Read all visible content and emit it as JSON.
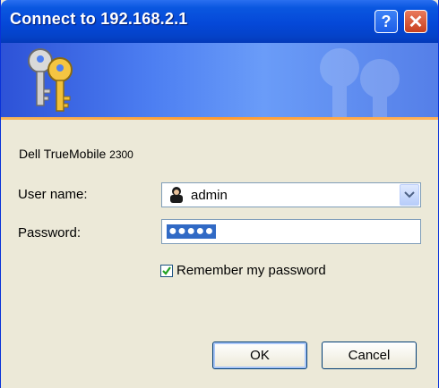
{
  "window": {
    "title": "Connect to 192.168.2.1",
    "help_glyph": "?",
    "close_glyph": "✕"
  },
  "banner": {
    "icon": "keys-icon"
  },
  "form": {
    "device_name": "Dell TrueMobile",
    "device_model": "2300",
    "username_label": "User name:",
    "username_value": "admin",
    "password_label": "Password:",
    "password_mask": "●●●●●",
    "remember_label": "Remember my password",
    "remember_checked": true
  },
  "buttons": {
    "ok": "OK",
    "cancel": "Cancel"
  },
  "colors": {
    "titlebar": "#0548d8",
    "banner_accent": "#ff9b30",
    "selection": "#316ac5"
  }
}
